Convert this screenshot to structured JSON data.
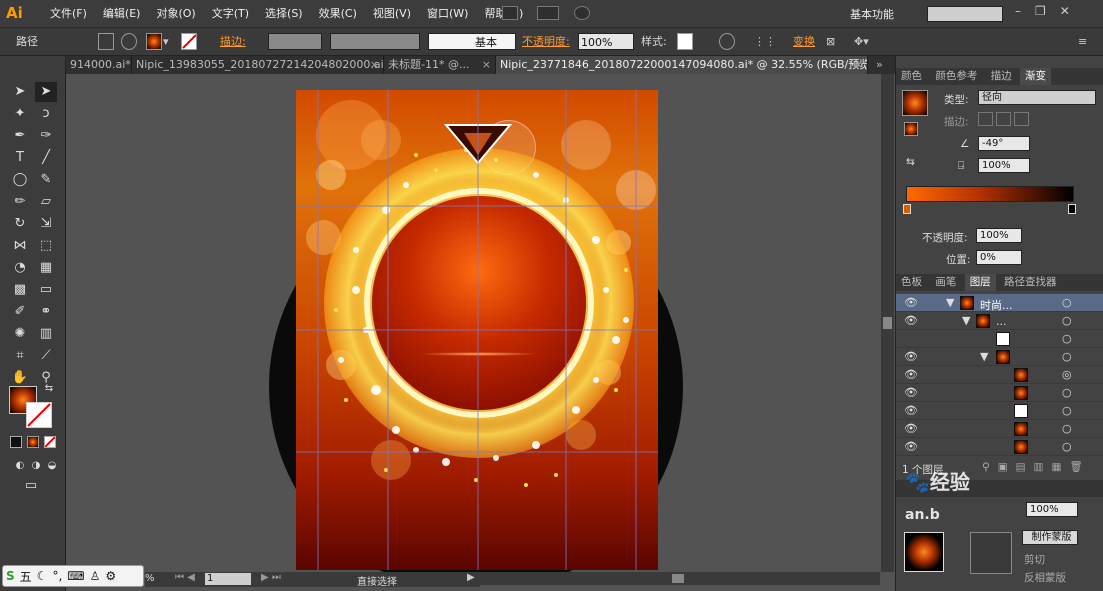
{
  "app": {
    "logo": "Ai"
  },
  "menu": [
    "文件(F)",
    "编辑(E)",
    "对象(O)",
    "文字(T)",
    "选择(S)",
    "效果(C)",
    "视图(V)",
    "窗口(W)",
    "帮助(H)"
  ],
  "workspace": "基本功能",
  "control": {
    "object_type": "路径",
    "stroke_label": "描边:",
    "brush_label": "基本",
    "opacity_label": "不透明度:",
    "opacity_value": "100%",
    "style_label": "样式:",
    "transform_label": "变换"
  },
  "tabs": [
    {
      "label": "914000.ai*"
    },
    {
      "label": "Nipic_13983055_20180727214204802000.ai*"
    },
    {
      "label": "未标题-11* @..."
    },
    {
      "label": "Nipic_23771846_20180722000147094080.ai* @ 32.55% (RGB/预览)"
    }
  ],
  "status": {
    "zoom": "%",
    "page": "1",
    "tool": "直接选择"
  },
  "gradient_panel": {
    "tabs": [
      "颜色",
      "颜色参考",
      "描边",
      "渐变"
    ],
    "type_label": "类型:",
    "type_value": "径向",
    "stroke_label": "描边:",
    "angle": "-49°",
    "aspect": "100%",
    "opacity_label": "不透明度:",
    "opacity_value": "100%",
    "location_label": "位置:",
    "location_value": "0%"
  },
  "layers_panel": {
    "tabs": [
      "色板",
      "画笔",
      "图层",
      "路径查找器"
    ],
    "layer_name": "时尚...",
    "sublayer_name": "...",
    "count": "1 个图层"
  },
  "transparency_panel": {
    "make_mask": "制作蒙版",
    "opacity_value": "100%",
    "clip": "剪切",
    "invert_mask": "反相蒙版"
  },
  "ime": {
    "label": "五"
  },
  "watermark": "经验",
  "watermark_sub": "an.b",
  "colors": {
    "accent_orange": "#ff9a2e",
    "selection_blue": "#586a86"
  }
}
